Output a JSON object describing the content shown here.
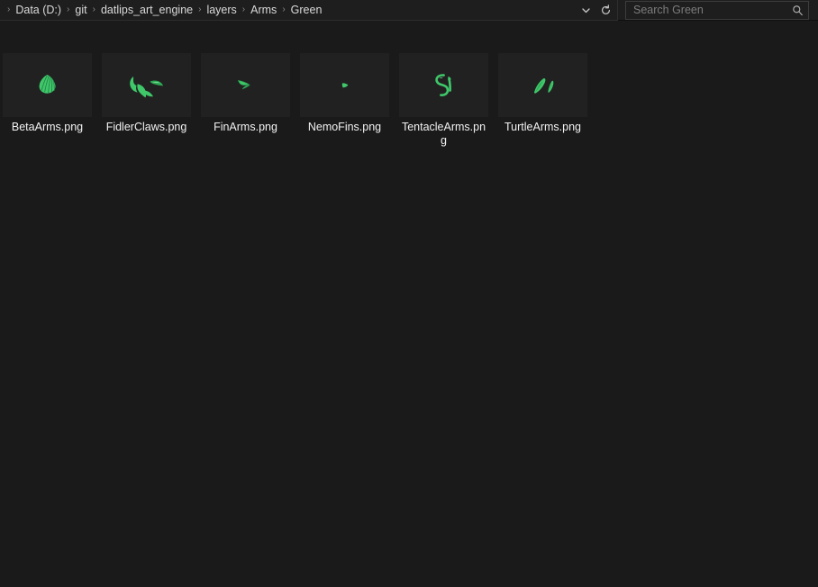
{
  "header": {
    "breadcrumb": {
      "separator": "›",
      "items": [
        {
          "label": "Data (D:)"
        },
        {
          "label": "git"
        },
        {
          "label": "datlips_art_engine"
        },
        {
          "label": "layers"
        },
        {
          "label": "Arms"
        },
        {
          "label": "Green"
        }
      ]
    },
    "dropdown_icon": "chevron-down-icon",
    "refresh_icon": "refresh-icon",
    "search": {
      "placeholder": "Search Green",
      "value": "",
      "icon": "search-icon"
    }
  },
  "colors": {
    "window_background": "#1a1a1a",
    "header_background": "#1e1e1e",
    "thumbnail_background": "#212121",
    "label_text": "#f2f2f2",
    "breadcrumb_text": "#dadada",
    "placeholder_text": "#7c7c7c",
    "asset_green": "#3fc76a"
  },
  "files": [
    {
      "name": "BetaArms.png",
      "icon": "fan-leaf-thumbnail"
    },
    {
      "name": "FidlerClaws.png",
      "icon": "claw-thumbnail"
    },
    {
      "name": "FinArms.png",
      "icon": "fin-thumbnail"
    },
    {
      "name": "NemoFins.png",
      "icon": "small-fin-thumbnail"
    },
    {
      "name": "TentacleArms.png",
      "icon": "tentacle-thumbnail"
    },
    {
      "name": "TurtleArms.png",
      "icon": "flipper-thumbnail"
    }
  ]
}
